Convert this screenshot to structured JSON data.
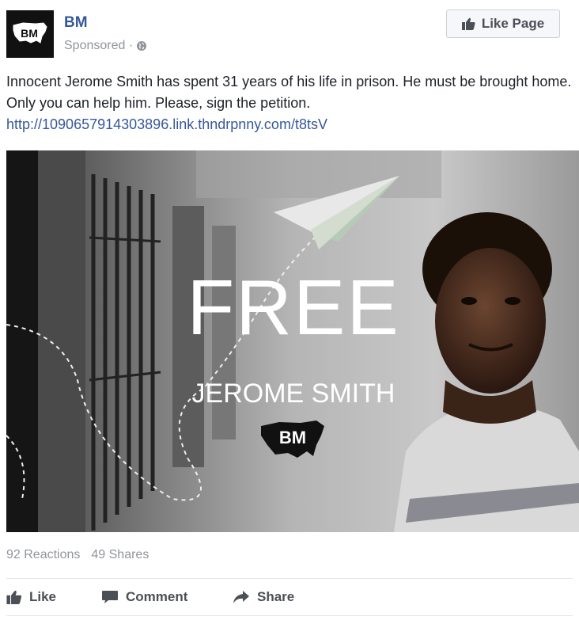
{
  "post": {
    "page_name": "BM",
    "sponsored": "Sponsored ·",
    "like_page_label": "Like Page",
    "logo_text": "BM",
    "text": "Innocent Jerome Smith has spent 31 years of his life in prison. He must be brought home. Only you can help him. Please, sign the petition.",
    "link": "http://1090657914303896.link.thndrpnny.com/t8tsV"
  },
  "image": {
    "headline": "FREE",
    "subheadline": "JEROME SMITH",
    "logo_text": "BM"
  },
  "stats": {
    "reactions": "92 Reactions",
    "shares": "49 Shares"
  },
  "actions": {
    "like": "Like",
    "comment": "Comment",
    "share": "Share"
  },
  "icons": {
    "thumbs_up": "thumbs-up-icon",
    "globe": "globe-icon",
    "comment": "comment-icon",
    "share": "share-arrow-icon",
    "paper_plane": "paper-plane-icon"
  },
  "colors": {
    "link": "#365899",
    "muted": "#90949c",
    "text": "#1d2129",
    "button_text": "#4b4f56"
  }
}
